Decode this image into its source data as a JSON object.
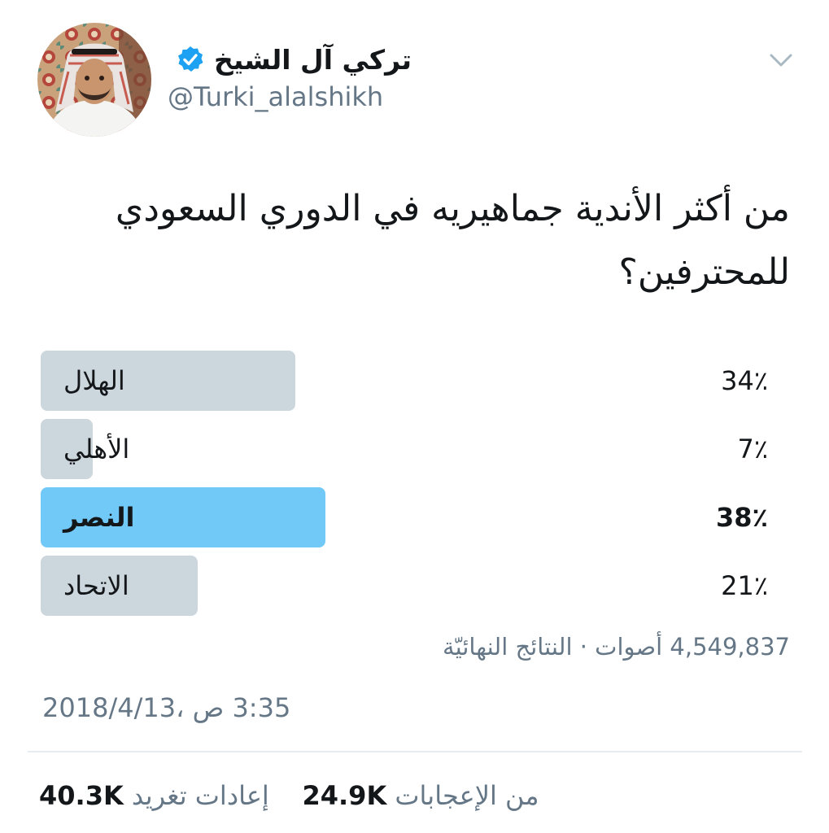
{
  "tweet": {
    "display_name": "تركي آل الشيخ",
    "handle": "@Turki_alalshikh",
    "verified": true,
    "text_line1": "من أكثر الأندية جماهيريه في الدوري السعودي",
    "text_line2": "للمحترفين؟"
  },
  "icons": {
    "avatar": "user-avatar-photo",
    "verified": "verified-badge-icon",
    "menu": "chevron-down-icon"
  },
  "colors": {
    "winner_bar": "#71c9f8",
    "bar": "#ccd6dd",
    "verified": "#1da1f2",
    "secondary_text": "#657786"
  },
  "poll": {
    "options": [
      {
        "label": "الهلال",
        "percent_label": "34٪",
        "percent": 34,
        "winner": false
      },
      {
        "label": "الأهلي",
        "percent_label": "7٪",
        "percent": 7,
        "winner": false
      },
      {
        "label": "النصر",
        "percent_label": "38٪",
        "percent": 38,
        "winner": true
      },
      {
        "label": "الاتحاد",
        "percent_label": "21٪",
        "percent": 21,
        "winner": false
      }
    ],
    "votes_text": "4,549,837 أصوات · النتائج النهائيّة"
  },
  "timestamp": "3:35 ص ،2018/4/13",
  "stats": {
    "retweets_count": "40.3K",
    "retweets_label": "إعادات تغريد",
    "likes_count": "24.9K",
    "likes_label": "من الإعجابات"
  }
}
